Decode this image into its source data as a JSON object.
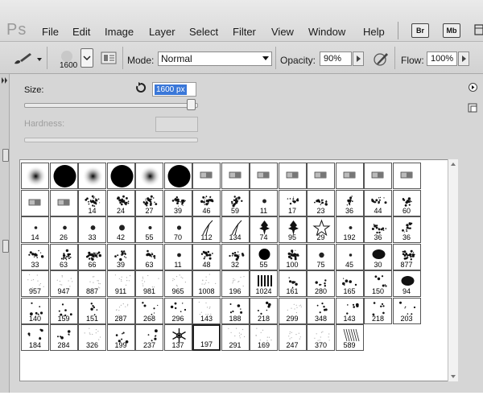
{
  "app": {
    "logo": "Ps"
  },
  "menu": [
    "File",
    "Edit",
    "Image",
    "Layer",
    "Select",
    "Filter",
    "View",
    "Window",
    "Help"
  ],
  "app_buttons": [
    "Br",
    "Mb"
  ],
  "options": {
    "brush_size": "1600",
    "mode_label": "Mode:",
    "mode_value": "Normal",
    "opacity_label": "Opacity:",
    "opacity_value": "90%",
    "flow_label": "Flow:",
    "flow_value": "100%"
  },
  "panel": {
    "size_label": "Size:",
    "size_value": "1600 px",
    "size_slider_fraction": 1.0,
    "hardness_label": "Hardness:"
  },
  "presets": [
    {
      "label": "",
      "kind": "soft"
    },
    {
      "label": "",
      "kind": "hard"
    },
    {
      "label": "",
      "kind": "soft"
    },
    {
      "label": "",
      "kind": "hard"
    },
    {
      "label": "",
      "kind": "soft"
    },
    {
      "label": "",
      "kind": "hard"
    },
    {
      "label": "",
      "kind": "tool"
    },
    {
      "label": "",
      "kind": "tool"
    },
    {
      "label": "",
      "kind": "tool"
    },
    {
      "label": "",
      "kind": "tool"
    },
    {
      "label": "",
      "kind": "tool"
    },
    {
      "label": "",
      "kind": "tool"
    },
    {
      "label": "",
      "kind": "tool"
    },
    {
      "label": "",
      "kind": "tool"
    },
    {
      "label": "",
      "kind": "tool"
    },
    {
      "label": "",
      "kind": "tool"
    },
    {
      "label": "14",
      "kind": "splat"
    },
    {
      "label": "24",
      "kind": "splat"
    },
    {
      "label": "27",
      "kind": "splat"
    },
    {
      "label": "39",
      "kind": "splat"
    },
    {
      "label": "46",
      "kind": "splat"
    },
    {
      "label": "59",
      "kind": "splat"
    },
    {
      "label": "11",
      "kind": "dot"
    },
    {
      "label": "17",
      "kind": "scatter"
    },
    {
      "label": "23",
      "kind": "scatter"
    },
    {
      "label": "36",
      "kind": "scatter"
    },
    {
      "label": "44",
      "kind": "scatter"
    },
    {
      "label": "60",
      "kind": "scatter"
    },
    {
      "label": "14",
      "kind": "dot"
    },
    {
      "label": "26",
      "kind": "dot"
    },
    {
      "label": "33",
      "kind": "dot"
    },
    {
      "label": "42",
      "kind": "dot"
    },
    {
      "label": "55",
      "kind": "dot"
    },
    {
      "label": "70",
      "kind": "dot"
    },
    {
      "label": "112",
      "kind": "grass"
    },
    {
      "label": "134",
      "kind": "grass"
    },
    {
      "label": "74",
      "kind": "leaf"
    },
    {
      "label": "95",
      "kind": "leaf"
    },
    {
      "label": "29",
      "kind": "star"
    },
    {
      "label": "192",
      "kind": "dot"
    },
    {
      "label": "36",
      "kind": "scatter"
    },
    {
      "label": "36",
      "kind": "scatter"
    },
    {
      "label": "33",
      "kind": "scatter"
    },
    {
      "label": "63",
      "kind": "scatter"
    },
    {
      "label": "66",
      "kind": "splat"
    },
    {
      "label": "39",
      "kind": "scatter"
    },
    {
      "label": "63",
      "kind": "scatter"
    },
    {
      "label": "11",
      "kind": "dot"
    },
    {
      "label": "48",
      "kind": "scatter"
    },
    {
      "label": "32",
      "kind": "scatter"
    },
    {
      "label": "55",
      "kind": "hard"
    },
    {
      "label": "100",
      "kind": "splat"
    },
    {
      "label": "75",
      "kind": "dot"
    },
    {
      "label": "45",
      "kind": "dot"
    },
    {
      "label": "30",
      "kind": "blob"
    },
    {
      "label": "877",
      "kind": "splat"
    },
    {
      "label": "957",
      "kind": "faint"
    },
    {
      "label": "947",
      "kind": "faint"
    },
    {
      "label": "887",
      "kind": "faint"
    },
    {
      "label": "911",
      "kind": "faint"
    },
    {
      "label": "981",
      "kind": "faint"
    },
    {
      "label": "965",
      "kind": "faint"
    },
    {
      "label": "1008",
      "kind": "faint"
    },
    {
      "label": "196",
      "kind": "faint"
    },
    {
      "label": "1024",
      "kind": "bars"
    },
    {
      "label": "161",
      "kind": "speck"
    },
    {
      "label": "280",
      "kind": "speck"
    },
    {
      "label": "165",
      "kind": "speck"
    },
    {
      "label": "150",
      "kind": "speck"
    },
    {
      "label": "94",
      "kind": "blob"
    },
    {
      "label": "140",
      "kind": "speck"
    },
    {
      "label": "159",
      "kind": "speck"
    },
    {
      "label": "151",
      "kind": "speck"
    },
    {
      "label": "287",
      "kind": "faint"
    },
    {
      "label": "268",
      "kind": "speck"
    },
    {
      "label": "296",
      "kind": "speck"
    },
    {
      "label": "143",
      "kind": "faint"
    },
    {
      "label": "188",
      "kind": "speck"
    },
    {
      "label": "218",
      "kind": "speck"
    },
    {
      "label": "299",
      "kind": "faint"
    },
    {
      "label": "348",
      "kind": "speck"
    },
    {
      "label": "143",
      "kind": "speck"
    },
    {
      "label": "218",
      "kind": "speck"
    },
    {
      "label": "203",
      "kind": "speck"
    },
    {
      "label": "184",
      "kind": "speck"
    },
    {
      "label": "284",
      "kind": "speck"
    },
    {
      "label": "326",
      "kind": "faint"
    },
    {
      "label": "199",
      "kind": "speck"
    },
    {
      "label": "237",
      "kind": "speck"
    },
    {
      "label": "137",
      "kind": "flake"
    },
    {
      "label": "197",
      "kind": "empty",
      "selected": true
    },
    {
      "label": "291",
      "kind": "faint"
    },
    {
      "label": "169",
      "kind": "faint"
    },
    {
      "label": "247",
      "kind": "faint"
    },
    {
      "label": "370",
      "kind": "faint"
    },
    {
      "label": "589",
      "kind": "scratch"
    }
  ]
}
